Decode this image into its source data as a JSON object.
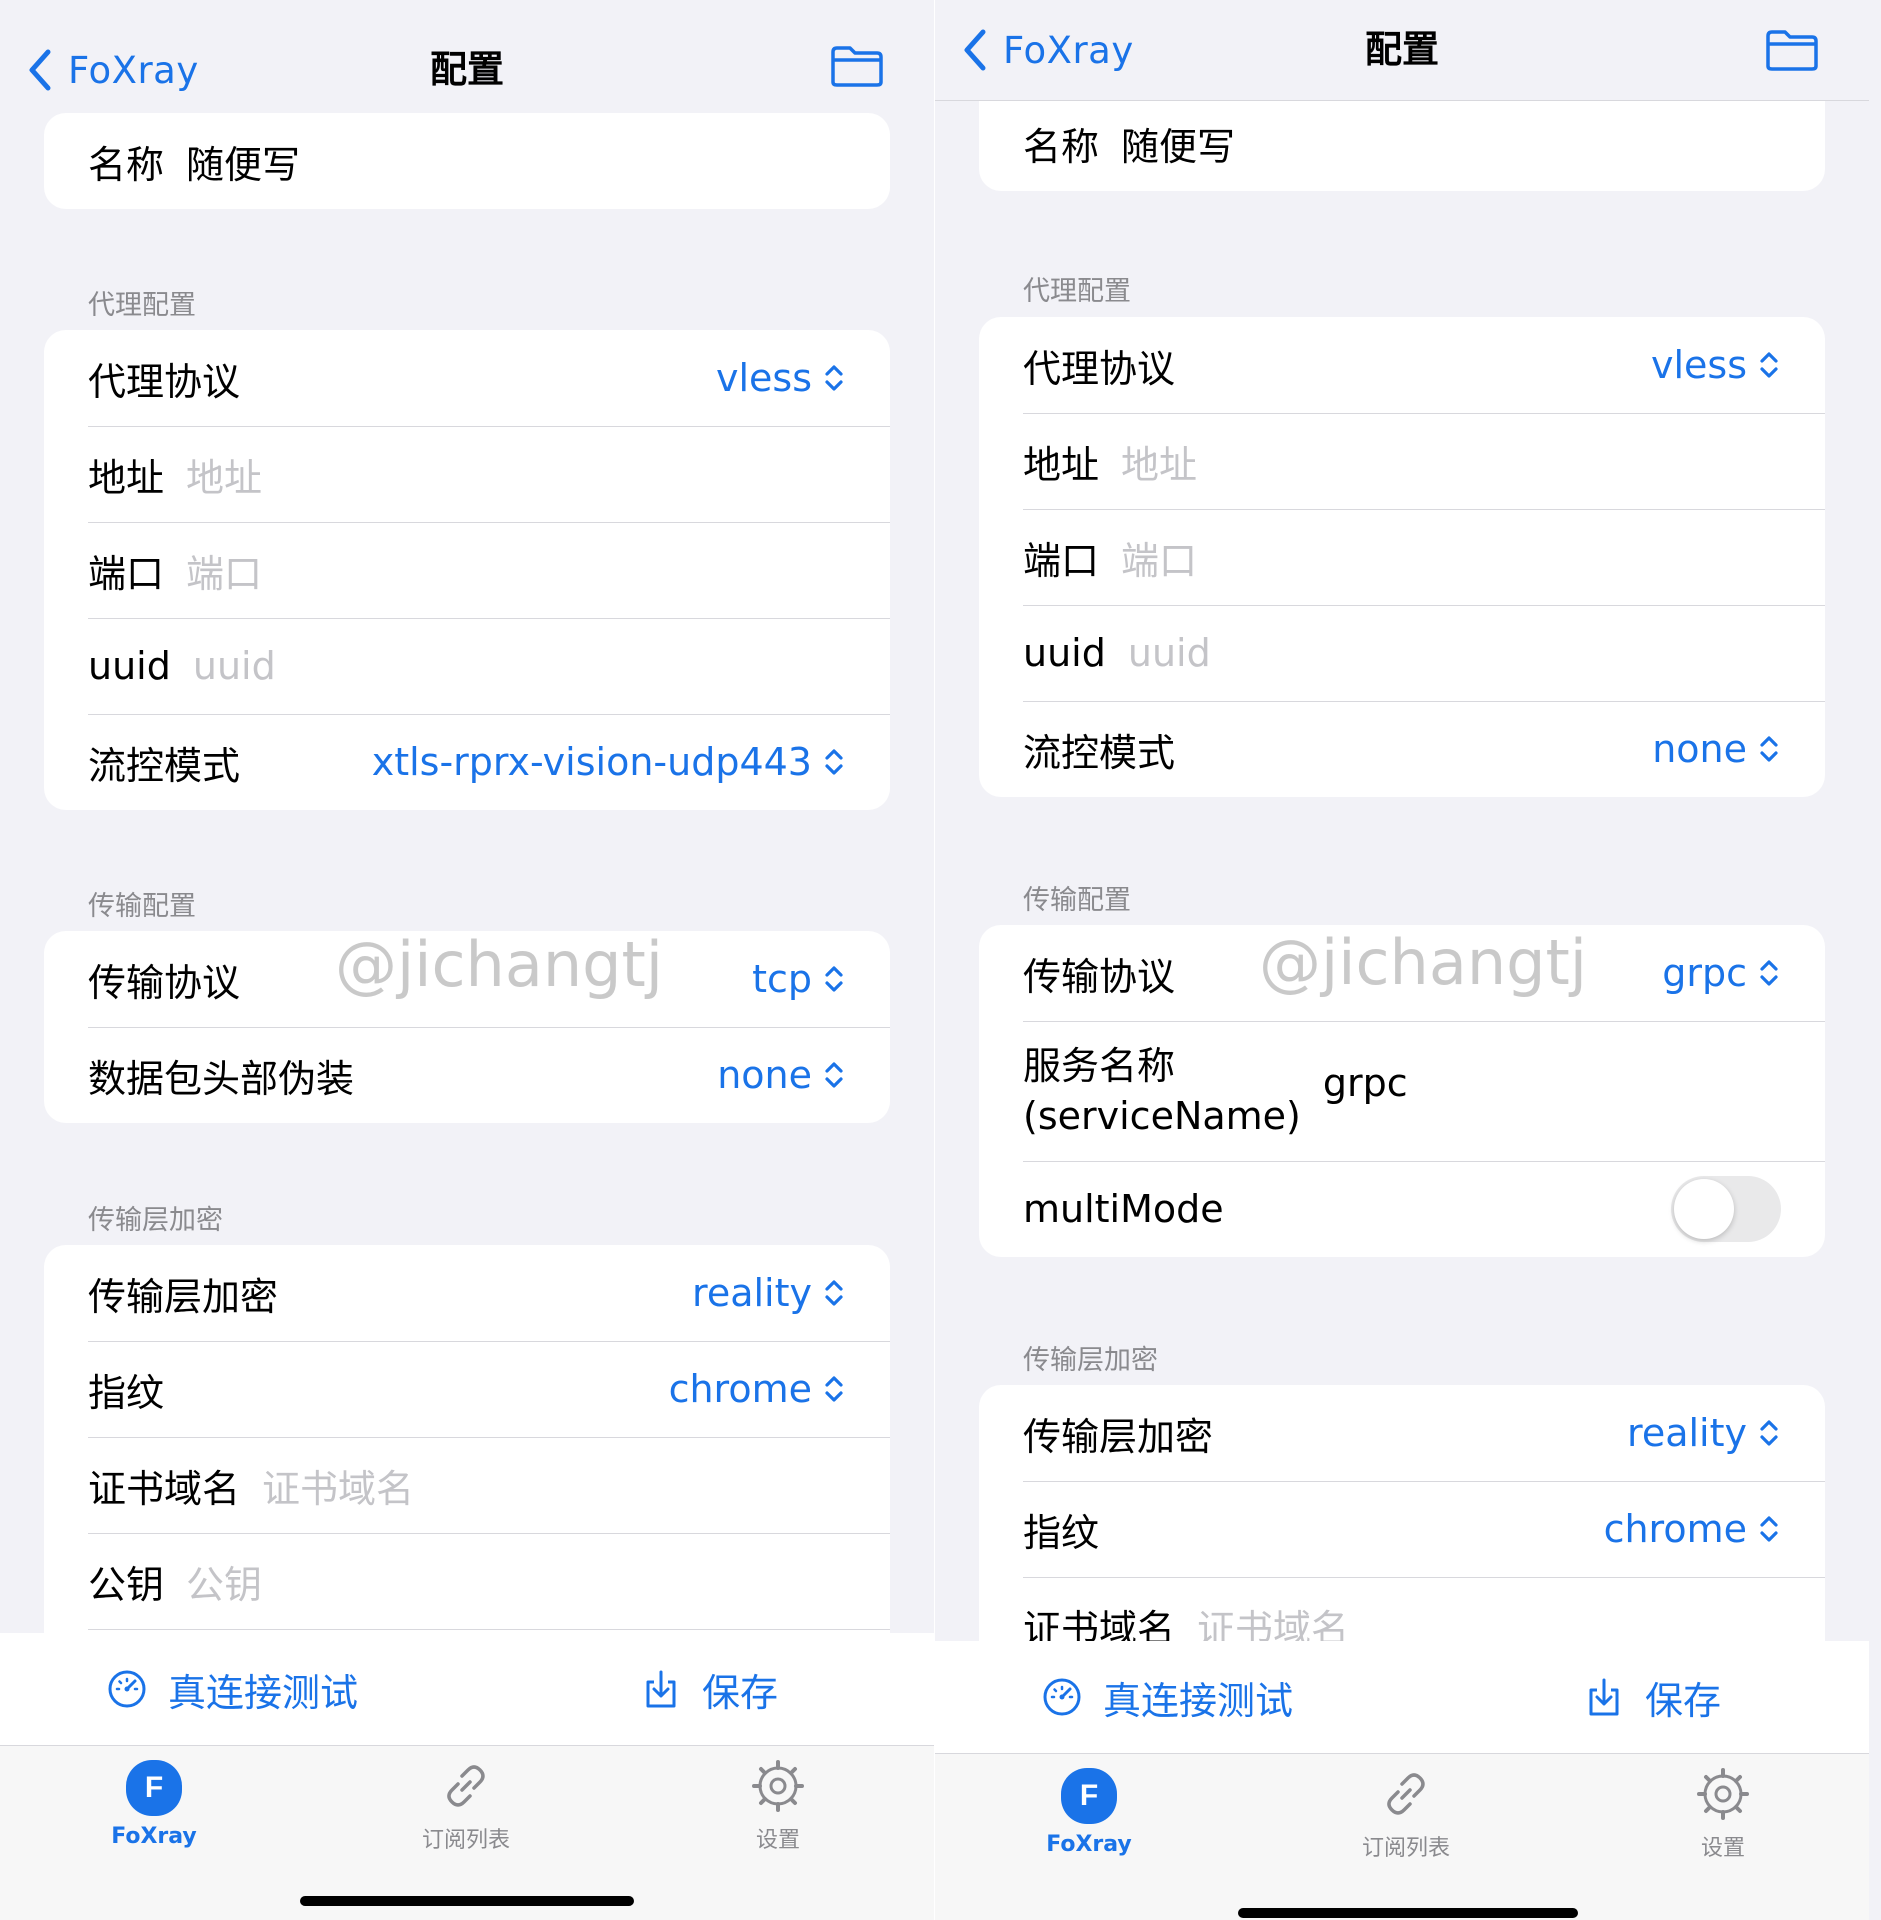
{
  "left": {
    "nav": {
      "back_label": "FoXray",
      "title": "配置"
    },
    "name_row": {
      "label": "名称",
      "value": "随便写"
    },
    "proxy_section": {
      "title": "代理配置",
      "protocol": {
        "label": "代理协议",
        "value": "vless"
      },
      "address": {
        "label": "地址",
        "placeholder": "地址"
      },
      "port": {
        "label": "端口",
        "placeholder": "端口"
      },
      "uuid": {
        "label": "uuid",
        "placeholder": "uuid"
      },
      "flow": {
        "label": "流控模式",
        "value": "xtls-rprx-vision-udp443"
      }
    },
    "transport_section": {
      "title": "传输配置",
      "protocol": {
        "label": "传输协议",
        "value": "tcp"
      },
      "header": {
        "label": "数据包头部伪装",
        "value": "none"
      }
    },
    "tls_section": {
      "title": "传输层加密",
      "security": {
        "label": "传输层加密",
        "value": "reality"
      },
      "fingerprint": {
        "label": "指纹",
        "value": "chrome"
      },
      "sni": {
        "label": "证书域名",
        "placeholder": "证书域名"
      },
      "public_key": {
        "label": "公钥",
        "placeholder": "公钥"
      }
    },
    "watermark": "@jichangtj",
    "actions": {
      "test_label": "真连接测试",
      "save_label": "保存"
    },
    "tabs": [
      {
        "label": "FoXray",
        "badge": "F"
      },
      {
        "label": "订阅列表"
      },
      {
        "label": "设置"
      }
    ]
  },
  "right": {
    "nav": {
      "back_label": "FoXray",
      "title": "配置"
    },
    "name_row": {
      "label": "名称",
      "value": "随便写"
    },
    "proxy_section": {
      "title": "代理配置",
      "protocol": {
        "label": "代理协议",
        "value": "vless"
      },
      "address": {
        "label": "地址",
        "placeholder": "地址"
      },
      "port": {
        "label": "端口",
        "placeholder": "端口"
      },
      "uuid": {
        "label": "uuid",
        "placeholder": "uuid"
      },
      "flow": {
        "label": "流控模式",
        "value": "none"
      }
    },
    "transport_section": {
      "title": "传输配置",
      "protocol": {
        "label": "传输协议",
        "value": "grpc"
      },
      "service_name": {
        "label_line1": "服务名称",
        "label_line2": "(serviceName)",
        "value": "grpc"
      },
      "multimode": {
        "label": "multiMode",
        "enabled": false
      }
    },
    "tls_section": {
      "title": "传输层加密",
      "security": {
        "label": "传输层加密",
        "value": "reality"
      },
      "fingerprint": {
        "label": "指纹",
        "value": "chrome"
      },
      "sni": {
        "label": "证书域名",
        "placeholder": "证书域名"
      }
    },
    "watermark": "@jichangtj",
    "actions": {
      "test_label": "真连接测试",
      "save_label": "保存"
    },
    "tabs": [
      {
        "label": "FoXray",
        "badge": "F"
      },
      {
        "label": "订阅列表"
      },
      {
        "label": "设置"
      }
    ]
  },
  "colors": {
    "accent": "#1a73e8",
    "background": "#f2f2f7",
    "placeholder": "#c4c4c8",
    "section_title": "#8a8a8e"
  },
  "icons": {
    "back": "chevron-left-icon",
    "folder": "folder-icon",
    "picker": "chevron-up-down-icon",
    "test": "speedometer-icon",
    "save": "download-icon",
    "subscriptions": "link-icon",
    "settings": "gear-icon"
  }
}
